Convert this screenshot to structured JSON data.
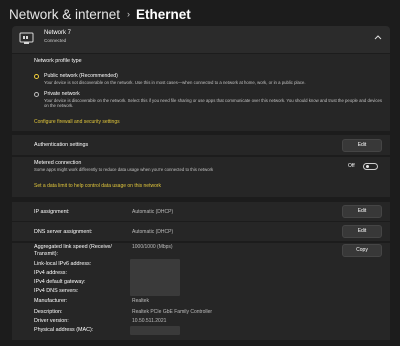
{
  "header": {
    "breadcrumb": "Network & internet",
    "separator": "›",
    "title": "Ethernet"
  },
  "adapter": {
    "name": "Network 7",
    "status": "Connected",
    "icon": "ethernet-icon",
    "expand_icon": "chevron-up-icon"
  },
  "profile": {
    "heading": "Network profile type",
    "options": [
      {
        "label": "Public network (Recommended)",
        "description": "Your device is not discoverable on the network. Use this in most cases—when connected to a network at home, work, or in a public place.",
        "selected": true
      },
      {
        "label": "Private network",
        "description": "Your device is discoverable on the network. Select this if you need file sharing or use apps that communicate over this network. You should know and trust the people and devices on the network.",
        "selected": false
      }
    ],
    "firewall_link": "Configure firewall and security settings"
  },
  "auth": {
    "label": "Authentication settings",
    "button": "Edit"
  },
  "metered": {
    "label": "Metered connection",
    "description": "Some apps might work differently to reduce data usage when you're connected to this network",
    "state_label": "Off",
    "on": false,
    "data_limit_link": "Set a data limit to help control data usage on this network"
  },
  "ip": {
    "assignment_label": "IP assignment:",
    "assignment_value": "Automatic (DHCP)",
    "assignment_button": "Edit",
    "dns_label": "DNS server assignment:",
    "dns_value": "Automatic (DHCP)",
    "dns_button": "Edit"
  },
  "properties": {
    "copy_button": "Copy",
    "link_speed_label": "Aggregated link speed (Receive/ Transmit):",
    "link_speed_value": "1000/1000 (Mbps)",
    "ipv6_label": "Link-local IPv6 address:",
    "ipv4_label": "IPv4 address:",
    "gateway_label": "IPv4 default gateway:",
    "dns_servers_label": "IPv4 DNS servers:",
    "manufacturer_label": "Manufacturer:",
    "manufacturer_value": "Realtek",
    "description_label": "Description:",
    "description_value": "Realtek PCIe GbE Family Controller",
    "driver_label": "Driver version:",
    "driver_value": "10.50.511.2021",
    "mac_label": "Physical address (MAC):"
  },
  "colors": {
    "accent": "#f2cf3c",
    "link": "#e2c73b",
    "background": "#1c1c1c",
    "card": "#2b2b2b"
  }
}
